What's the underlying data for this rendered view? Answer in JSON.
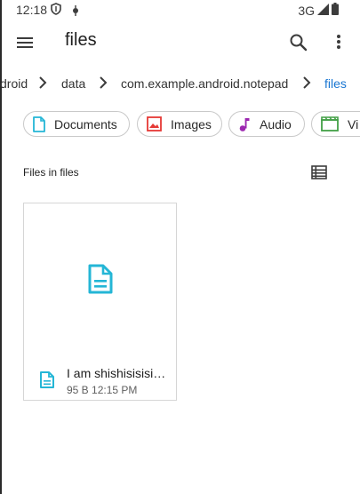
{
  "status_bar": {
    "time": "12:18",
    "network": "3G",
    "icons": [
      "shield-icon",
      "notification-icon",
      "signal-icon",
      "battery-icon"
    ]
  },
  "app_bar": {
    "title": "files",
    "icons": [
      "menu-icon",
      "search-icon",
      "more-vert-icon"
    ]
  },
  "breadcrumb": {
    "items": [
      {
        "label": "droid"
      },
      {
        "label": "data"
      },
      {
        "label": "com.example.android.notepad"
      },
      {
        "label": "files"
      }
    ]
  },
  "chips": [
    {
      "label": "Documents",
      "icon": "document-icon",
      "color": "#24b6d6"
    },
    {
      "label": "Images",
      "icon": "image-icon",
      "color": "#e53935"
    },
    {
      "label": "Audio",
      "icon": "audio-icon",
      "color": "#9c27b0"
    },
    {
      "label": "Vi",
      "icon": "video-icon",
      "color": "#43a047"
    }
  ],
  "section": {
    "title": "Files in files",
    "view_toggle_icon": "list-view-icon"
  },
  "files": [
    {
      "name": "I am shishisisisi…",
      "size": "95 B",
      "time": "12:15 PM",
      "meta": "95 B  12:15 PM",
      "icon": "text-file-icon",
      "icon_color": "#24b6d6"
    }
  ],
  "colors": {
    "accent": "#1976d2",
    "doc_icon": "#24b6d6"
  }
}
